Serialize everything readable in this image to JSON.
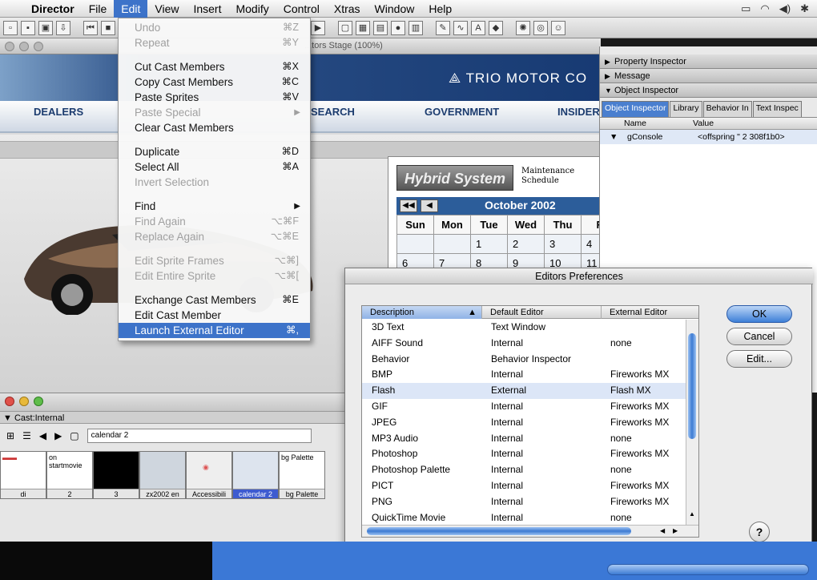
{
  "menubar": {
    "app": "Director",
    "items": [
      "File",
      "Edit",
      "View",
      "Insert",
      "Modify",
      "Control",
      "Xtras",
      "Window",
      "Help"
    ],
    "active": "Edit"
  },
  "stage": {
    "title": "...tors Stage (100%)",
    "brand": "TRIO MOTOR CO",
    "nav": [
      "DEALERS",
      "SEARCH",
      "GOVERNMENT",
      "INSIDER"
    ]
  },
  "calendar": {
    "logo": "Hybrid System",
    "caption": "Maintenance Schedule",
    "month": "October 2002",
    "days": [
      "Sun",
      "Mon",
      "Tue",
      "Wed",
      "Thu",
      "F"
    ],
    "week1": [
      "",
      "",
      "1",
      "2",
      "3",
      "4"
    ],
    "week2": [
      "6",
      "7",
      "8",
      "9",
      "10",
      "11"
    ]
  },
  "edit_menu": {
    "items": [
      {
        "label": "Undo",
        "shortcut": "⌘Z",
        "disabled": true
      },
      {
        "label": "Repeat",
        "shortcut": "⌘Y",
        "disabled": true
      },
      {
        "sep": true
      },
      {
        "label": "Cut Cast Members",
        "shortcut": "⌘X"
      },
      {
        "label": "Copy Cast Members",
        "shortcut": "⌘C"
      },
      {
        "label": "Paste Sprites",
        "shortcut": "⌘V"
      },
      {
        "label": "Paste Special",
        "submenu": true,
        "disabled": true
      },
      {
        "label": "Clear Cast Members"
      },
      {
        "sep": true
      },
      {
        "label": "Duplicate",
        "shortcut": "⌘D"
      },
      {
        "label": "Select All",
        "shortcut": "⌘A"
      },
      {
        "label": "Invert Selection",
        "disabled": true
      },
      {
        "sep": true
      },
      {
        "label": "Find",
        "submenu": true
      },
      {
        "label": "Find Again",
        "shortcut": "⌥⌘F",
        "disabled": true
      },
      {
        "label": "Replace Again",
        "shortcut": "⌥⌘E",
        "disabled": true
      },
      {
        "sep": true
      },
      {
        "label": "Edit Sprite Frames",
        "shortcut": "⌥⌘]",
        "disabled": true
      },
      {
        "label": "Edit Entire Sprite",
        "shortcut": "⌥⌘[",
        "disabled": true
      },
      {
        "sep": true
      },
      {
        "label": "Exchange Cast Members",
        "shortcut": "⌘E"
      },
      {
        "label": "Edit Cast Member"
      },
      {
        "label": "Launch External Editor",
        "shortcut": "⌘,",
        "highlighted": true
      }
    ]
  },
  "inspector": {
    "panels": [
      "Property Inspector",
      "Message",
      "Object Inspector"
    ],
    "tabs": [
      "Object Inspector",
      "Library",
      "Behavior In",
      "Text Inspec"
    ],
    "col_name": "Name",
    "col_value": "Value",
    "row_name": "gConsole",
    "row_value": "<offspring \" 2 308f1b0>"
  },
  "cast": {
    "title": "Cast:Internal",
    "name_field": "calendar 2",
    "thumbs": [
      {
        "top": "",
        "label": "di"
      },
      {
        "top": "on startmovie",
        "label": "2"
      },
      {
        "top": "",
        "label": "3"
      },
      {
        "top": "",
        "label": "zx2002 en"
      },
      {
        "top": "",
        "label": "Accessibili"
      },
      {
        "top": "",
        "label": "calendar 2",
        "selected": true
      },
      {
        "top": "bg Palette",
        "label": "bg Palette"
      }
    ]
  },
  "dialog": {
    "title": "Editors Preferences",
    "columns": [
      "Description",
      "Default Editor",
      "External Editor"
    ],
    "rows": [
      [
        "3D Text",
        "Text Window",
        ""
      ],
      [
        "AIFF Sound",
        "Internal",
        "none"
      ],
      [
        "Behavior",
        "Behavior Inspector",
        ""
      ],
      [
        "BMP",
        "Internal",
        "Fireworks MX"
      ],
      [
        "Flash",
        "External",
        "Flash MX"
      ],
      [
        "GIF",
        "Internal",
        "Fireworks MX"
      ],
      [
        "JPEG",
        "Internal",
        "Fireworks MX"
      ],
      [
        "MP3 Audio",
        "Internal",
        "none"
      ],
      [
        "Photoshop",
        "Internal",
        "Fireworks MX"
      ],
      [
        "Photoshop Palette",
        "Internal",
        "none"
      ],
      [
        "PICT",
        "Internal",
        "Fireworks MX"
      ],
      [
        "PNG",
        "Internal",
        "Fireworks MX"
      ],
      [
        "QuickTime Movie",
        "Internal",
        "none"
      ]
    ],
    "selected_row": 4,
    "ok": "OK",
    "cancel": "Cancel",
    "edit": "Edit...",
    "help": "?"
  }
}
